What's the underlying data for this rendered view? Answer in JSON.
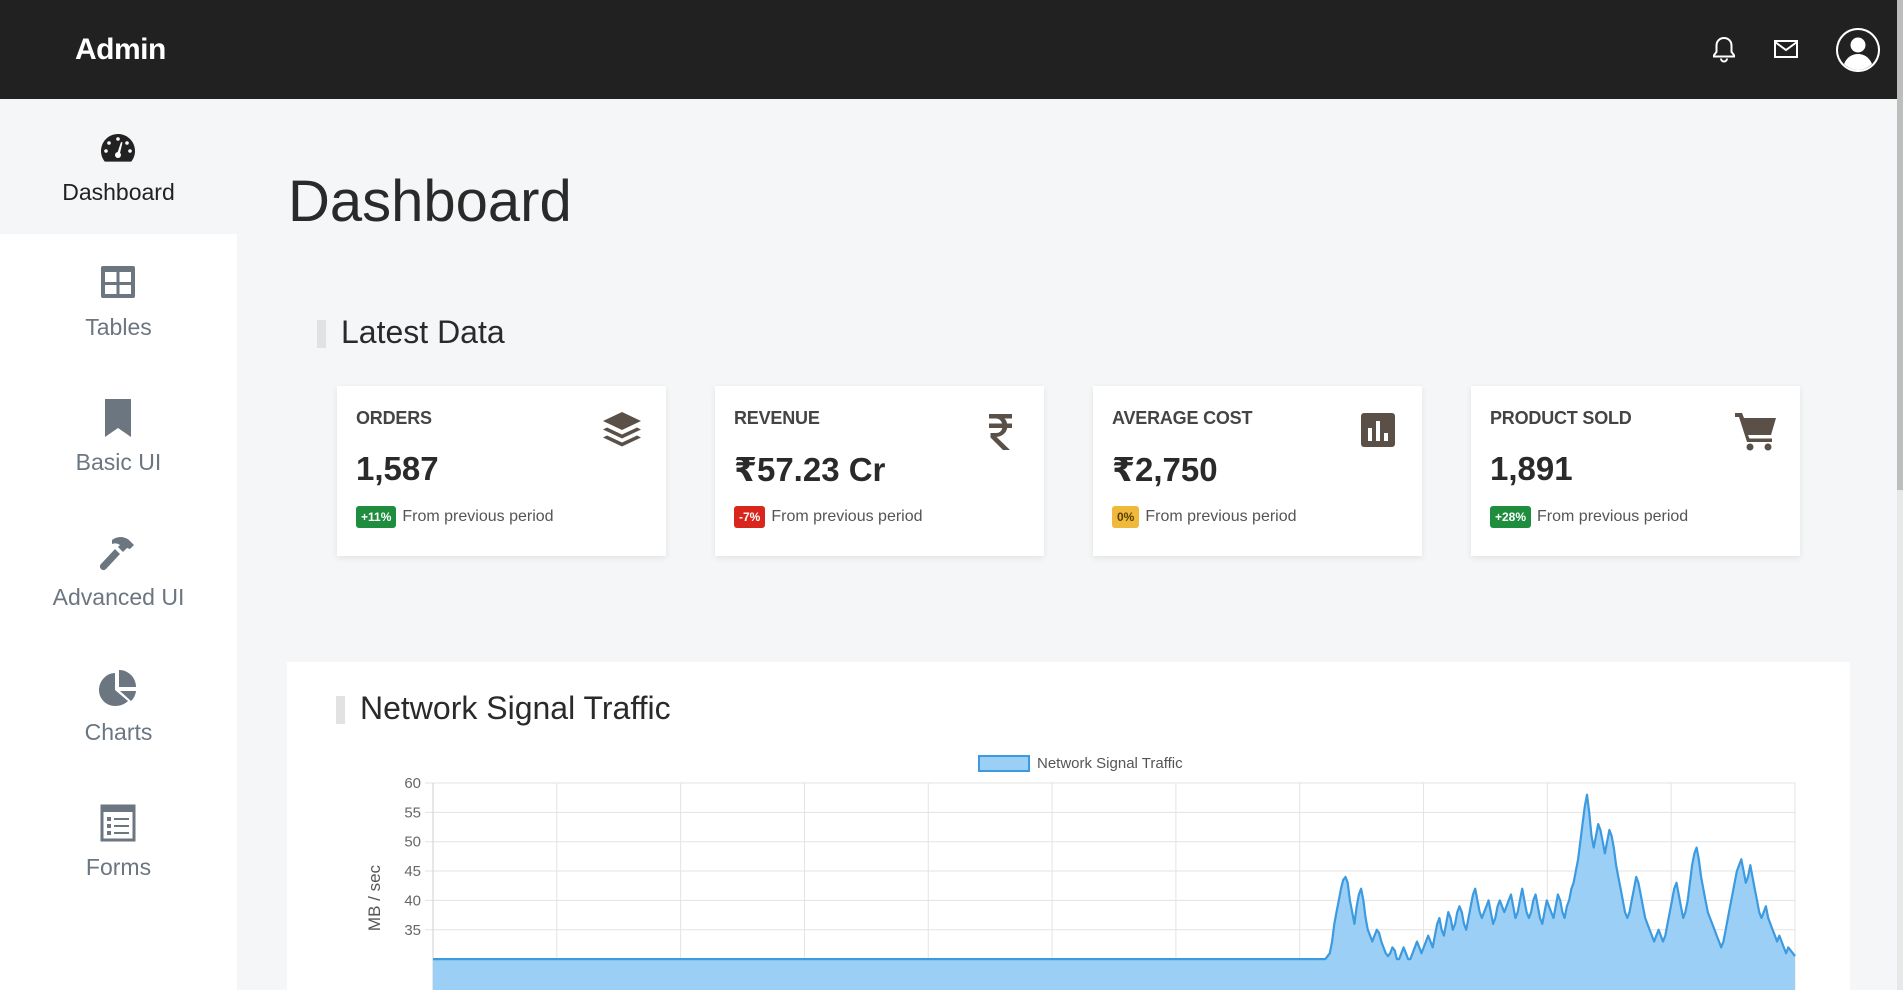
{
  "header": {
    "brand": "Admin",
    "icons": [
      "bell-icon",
      "mail-icon",
      "user-avatar-icon"
    ]
  },
  "sidebar": {
    "items": [
      {
        "label": "Dashboard",
        "icon": "speedometer-icon",
        "active": true
      },
      {
        "label": "Tables",
        "icon": "table-icon",
        "active": false
      },
      {
        "label": "Basic UI",
        "icon": "bookmark-icon",
        "active": false
      },
      {
        "label": "Advanced UI",
        "icon": "hammer-icon",
        "active": false
      },
      {
        "label": "Charts",
        "icon": "pie-chart-icon",
        "active": false
      },
      {
        "label": "Forms",
        "icon": "form-icon",
        "active": false
      }
    ]
  },
  "main": {
    "title": "Dashboard",
    "latest_title": "Latest Data",
    "cards": [
      {
        "title": "ORDERS",
        "value": "1,587",
        "badge": "+11%",
        "badge_color": "#1e8e3e",
        "footer": "From previous period",
        "icon": "layers-icon"
      },
      {
        "title": "REVENUE",
        "value": "₹57.23 Cr",
        "badge": "-7%",
        "badge_color": "#d9261c",
        "footer": "From previous period",
        "icon": "rupee-icon"
      },
      {
        "title": "AVERAGE COST",
        "value": "₹2,750",
        "badge": "0%",
        "badge_color": "#efb93c",
        "footer": "From previous period",
        "icon": "bar-chart-icon"
      },
      {
        "title": "PRODUCT SOLD",
        "value": "1,891",
        "badge": "+28%",
        "badge_color": "#1e8e3e",
        "footer": "From previous period",
        "icon": "cart-icon"
      }
    ],
    "traffic_title": "Network Signal Traffic"
  },
  "chart_data": {
    "type": "area",
    "title": "",
    "xlabel": "",
    "ylabel": "MB / sec",
    "legend": [
      "Network Signal Traffic"
    ],
    "legend_position": "top-center",
    "color": "#3b9ae0",
    "fill": "#9ccff5",
    "ylim": [
      30,
      60
    ],
    "yticks": [
      35,
      40,
      45,
      50,
      55,
      60
    ],
    "grid": true,
    "series": [
      {
        "name": "Network Signal Traffic",
        "values": [
          30,
          30,
          30,
          30,
          30,
          30,
          30,
          30,
          30,
          30,
          30,
          30,
          30,
          30,
          30,
          30,
          30,
          30,
          30,
          30,
          30,
          30,
          30,
          30,
          30,
          30,
          30,
          30,
          30,
          30,
          30,
          30,
          30,
          30,
          30,
          30,
          30,
          30,
          30,
          30,
          30,
          30,
          30,
          30,
          30,
          30,
          30,
          30,
          30,
          30,
          30,
          30,
          30,
          30,
          30,
          30,
          30,
          30,
          30,
          30,
          30,
          30,
          30,
          30,
          30,
          30,
          30,
          30,
          30,
          30,
          30,
          30,
          30,
          30,
          30,
          30,
          30,
          30,
          30,
          30,
          30,
          30,
          30,
          30,
          30,
          30,
          30,
          30,
          30,
          30,
          30,
          30,
          30,
          30,
          30,
          30,
          30,
          30,
          30,
          30,
          30,
          30,
          30,
          30,
          30,
          30,
          30,
          30,
          30,
          30,
          30,
          30,
          30,
          30,
          30,
          30,
          30,
          30,
          30,
          30,
          30,
          30,
          30,
          30,
          30,
          30,
          30,
          30,
          30,
          30,
          30,
          30,
          30,
          30,
          30,
          30,
          30,
          30,
          30,
          30,
          30,
          30,
          30,
          30,
          30,
          30,
          30,
          30,
          30,
          30,
          30,
          30,
          30,
          30,
          30,
          30,
          30,
          30,
          30,
          30,
          30,
          30,
          30,
          30,
          30,
          30,
          30,
          30,
          30,
          30,
          30,
          30,
          30,
          30,
          30,
          30,
          30,
          30,
          30,
          30,
          30,
          30,
          30,
          30,
          30,
          30,
          30,
          30,
          30,
          30,
          30,
          30,
          30,
          30,
          30,
          30,
          30,
          30,
          30,
          30,
          30,
          30,
          30,
          30,
          30,
          30,
          30,
          30,
          30,
          30,
          30,
          30,
          30,
          30,
          30,
          30,
          30,
          30,
          30,
          30,
          30,
          30,
          30,
          30,
          30,
          30,
          30,
          30,
          30,
          30,
          30,
          30,
          30,
          30,
          30,
          30,
          30,
          30,
          30,
          30,
          30,
          30,
          30,
          30,
          30,
          30,
          30,
          30,
          30,
          30,
          30,
          30,
          30,
          30,
          30,
          30,
          30,
          30,
          30,
          30,
          30,
          30,
          30,
          30,
          30,
          30,
          30,
          30,
          30,
          30,
          30,
          30,
          30,
          30,
          30,
          30,
          30,
          30,
          30,
          30,
          30,
          30,
          30,
          30,
          30,
          30,
          30,
          30,
          30,
          30,
          30,
          30,
          30,
          30,
          30,
          30,
          30,
          30,
          30,
          30,
          30,
          30,
          30,
          30,
          30,
          30,
          30,
          30,
          30,
          30,
          30,
          30,
          30,
          30,
          30,
          30,
          30,
          30,
          30,
          30,
          30,
          30,
          30,
          30,
          30,
          30,
          30,
          30,
          30,
          30,
          30,
          30,
          30,
          30,
          30,
          30,
          30,
          30,
          30,
          30,
          30,
          30,
          30,
          30,
          30,
          30,
          30,
          30,
          30,
          30,
          30,
          30,
          30,
          30,
          30,
          30,
          30,
          30,
          30,
          30,
          30,
          30,
          30,
          30,
          30,
          30,
          30,
          30,
          30,
          30,
          30,
          30,
          30,
          30,
          30,
          30,
          30,
          30,
          30,
          30,
          30,
          30,
          30,
          30,
          30,
          30,
          30,
          30,
          30,
          30,
          30,
          30,
          30,
          30,
          30,
          30,
          30,
          30,
          30,
          30,
          30.5,
          31,
          33,
          36,
          38,
          40,
          42,
          43.5,
          44,
          43,
          40,
          38,
          36,
          39,
          41,
          42,
          40,
          37,
          35,
          34,
          33,
          34,
          35,
          34.5,
          33,
          32,
          31,
          30.5,
          31,
          32,
          31.5,
          30,
          30,
          31,
          32,
          31,
          30,
          30,
          31,
          32,
          33,
          32,
          31,
          32,
          33,
          34,
          33,
          32,
          34,
          36,
          37,
          35,
          34,
          36,
          38,
          37,
          35,
          36,
          38,
          39,
          38,
          36,
          35,
          37,
          39,
          41,
          42,
          40,
          38,
          37,
          38,
          39,
          40,
          38,
          36,
          37,
          39,
          40,
          39,
          38,
          39,
          40,
          41,
          39,
          37,
          38,
          40,
          42,
          40,
          38,
          37,
          38,
          40,
          41,
          39,
          37,
          36,
          38,
          40,
          39,
          38,
          37,
          39,
          41,
          40,
          38,
          37,
          39,
          40,
          42,
          43,
          45,
          47,
          50,
          53,
          56,
          58,
          55,
          51,
          49,
          51,
          53,
          52,
          50,
          48,
          50,
          52,
          51,
          49,
          46,
          44,
          42,
          40,
          38,
          37,
          38,
          40,
          42,
          44,
          43,
          41,
          39,
          37,
          36,
          35,
          34,
          33,
          34,
          35,
          34,
          33,
          34,
          36,
          38,
          40,
          42,
          43,
          41,
          39,
          37,
          38,
          40,
          43,
          46,
          48,
          49,
          47,
          44,
          42,
          40,
          38,
          37,
          36,
          35,
          34,
          33,
          32,
          33,
          35,
          37,
          39,
          41,
          43,
          45,
          46,
          47,
          45,
          43,
          44,
          46,
          44,
          42,
          40,
          38,
          37,
          38,
          39,
          37,
          36,
          35,
          34,
          33,
          34,
          33,
          32,
          31,
          32,
          31.5,
          31,
          30.5
        ]
      }
    ]
  }
}
